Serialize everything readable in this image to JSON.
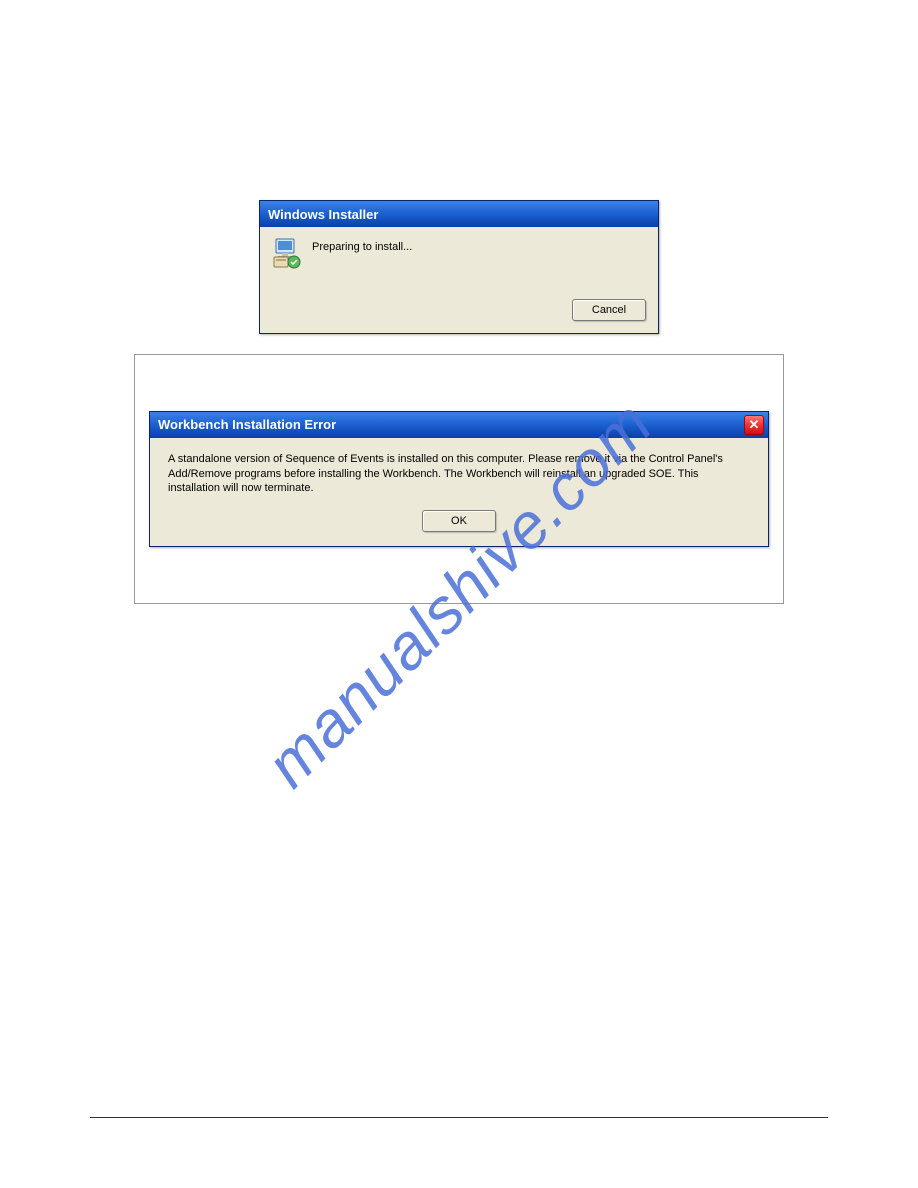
{
  "watermark": "manualshive.com",
  "dialog1": {
    "title": "Windows Installer",
    "message": "Preparing to install...",
    "cancel_label": "Cancel"
  },
  "dialog2": {
    "title": "Workbench Installation Error",
    "message": "A standalone version of Sequence of Events is installed on this computer. Please remove it via the Control Panel's Add/Remove programs before installing the Workbench. The Workbench will reinstall an upgraded SOE. This installation will now terminate.",
    "ok_label": "OK",
    "close_glyph": "✕"
  }
}
